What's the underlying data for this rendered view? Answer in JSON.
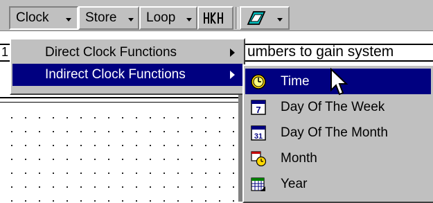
{
  "toolbar": {
    "clock_label": "Clock",
    "store_label": "Store",
    "loop_label": "Loop",
    "counter_icon": "counter-icon",
    "eraser_icon": "eraser-icon"
  },
  "document": {
    "left_char": "1",
    "visible_text": "umbers to gain system"
  },
  "clock_menu": {
    "items": [
      {
        "label": "Direct Clock Functions",
        "has_submenu": true,
        "selected": false
      },
      {
        "label": "Indirect Clock Functions",
        "has_submenu": true,
        "selected": true
      }
    ]
  },
  "indirect_submenu": {
    "items": [
      {
        "label": "Time",
        "icon": "clock-icon",
        "selected": true
      },
      {
        "label": "Day Of The Week",
        "icon": "calendar-7-icon",
        "selected": false
      },
      {
        "label": "Day Of The Month",
        "icon": "calendar-31-icon",
        "selected": false
      },
      {
        "label": "Month",
        "icon": "calendar-clock-icon",
        "selected": false
      },
      {
        "label": "Year",
        "icon": "calendar-grid-icon",
        "selected": false
      }
    ]
  },
  "colors": {
    "menu_bg": "#c0c0c0",
    "highlight": "#000080"
  }
}
